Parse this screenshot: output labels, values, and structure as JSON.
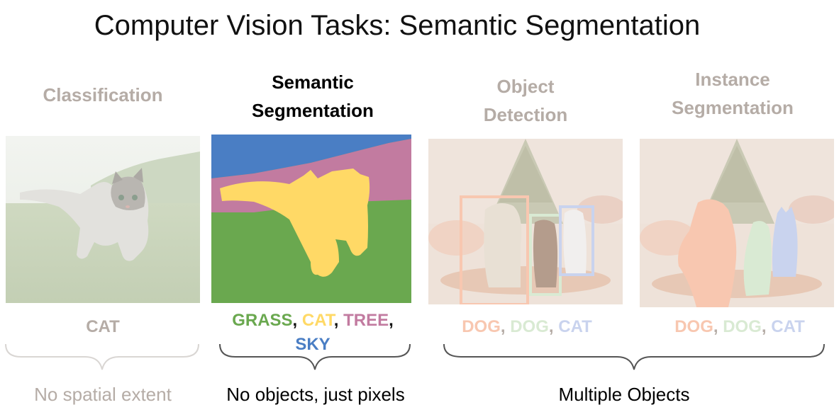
{
  "title": "Computer Vision Tasks: Semantic Segmentation",
  "columns": {
    "classification": {
      "heading": "Classification",
      "label": "CAT",
      "caption": "No spatial extent"
    },
    "semantic": {
      "heading_line1": "Semantic",
      "heading_line2": "Segmentation",
      "labels": [
        "GRASS",
        "CAT",
        "TREE",
        "SKY"
      ],
      "caption": "No objects, just pixels"
    },
    "detection": {
      "heading_line1": "Object",
      "heading_line2": "Detection",
      "labels": [
        "DOG",
        "DOG",
        "CAT"
      ]
    },
    "instance": {
      "heading_line1": "Instance",
      "heading_line2": "Segmentation",
      "labels": [
        "DOG",
        "DOG",
        "CAT"
      ]
    }
  },
  "shared_caption": "Multiple Objects",
  "separator": ",",
  "colors": {
    "grass": "#6aa84f",
    "cat": "#ffd966",
    "tree": "#c27ba0",
    "sky": "#4a7ec4",
    "dog1": "#f8c7b0",
    "dog2": "#d9ead3",
    "cat_box": "#c9d3ee"
  }
}
